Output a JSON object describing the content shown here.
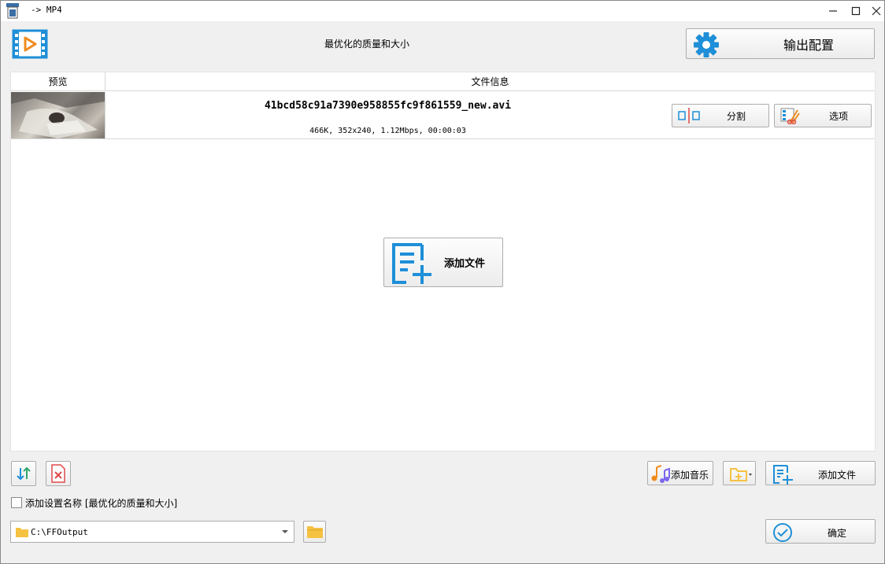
{
  "window": {
    "title": "-> MP4"
  },
  "header": {
    "profile_name": "最优化的质量和大小",
    "output_settings_label": "输出配置"
  },
  "list": {
    "columns": [
      "预览",
      "文件信息"
    ],
    "files": [
      {
        "name": "41bcd58c91a7390e958855fc9f861559_new.avi",
        "meta": "466K, 352x240, 1.12Mbps, 00:00:03",
        "split_label": "分割",
        "options_label": "选项"
      }
    ],
    "add_file_label": "添加文件"
  },
  "bottom": {
    "add_music_label": "添加音乐",
    "add_file_label": "添加文件",
    "add_setting_name_label": "添加设置名称 [最优化的质量和大小]",
    "add_setting_name_checked": false,
    "output_path": "C:\\FFOutput",
    "ok_label": "确定"
  },
  "colors": {
    "accent_blue": "#1e8fd8",
    "folder_yellow": "#f5c242",
    "red": "#e0484a"
  }
}
